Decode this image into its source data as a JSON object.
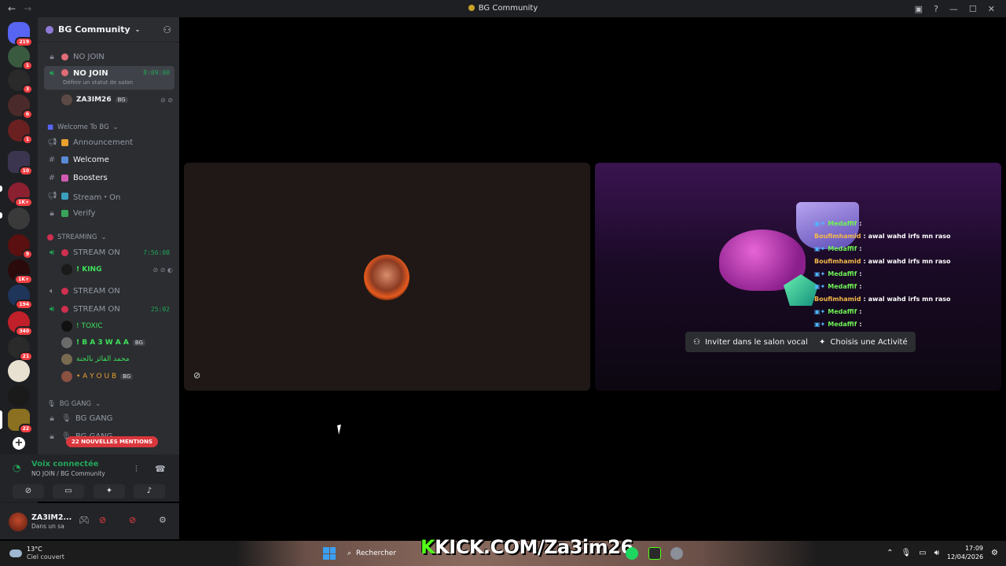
{
  "window": {
    "title": "BG Community"
  },
  "rail": {
    "badges": [
      "219",
      "1",
      "3",
      "6",
      "1",
      "10",
      "1K+",
      "9",
      "1K+",
      "194",
      "340",
      "21",
      "22"
    ]
  },
  "guild": {
    "name": "BG Community"
  },
  "channels": {
    "no_join_1": "NO JOIN",
    "no_join_2": "NO JOIN",
    "no_join_2_time": "8:09:00",
    "no_join_2_status": "Définir un statut de salon",
    "user_za3im": "ZA3IM26",
    "cat_welcome": "Welcome To BG",
    "announcement": "Announcement",
    "welcome": "Welcome",
    "boosters": "Boosters",
    "stream": "Stream・On",
    "verify": "Verify",
    "cat_streaming": "STREAMING",
    "stream_on_1": "STREAM ON",
    "stream_on_1_time": "7:56:08",
    "user_king": "! KING",
    "stream_on_2": "STREAM ON",
    "stream_on_3": "STREAM ON",
    "stream_on_3_time": "25:02",
    "user_toxic": "! TOXIC",
    "user_ba3waa": "! B A 3 W A A",
    "user_arabic": "محمد الفائز بالجنة",
    "user_ayoub": "• A Y O U B",
    "tag_bg": "BG",
    "cat_bggang": "BG GANG",
    "bg_gang_1": "BG GANG",
    "bg_gang_2": "BG GANG",
    "mentions": "22 NOUVELLES MENTIONS"
  },
  "voice": {
    "status": "Voix connectée",
    "location": "NO JOIN / BG Community"
  },
  "userpanel": {
    "name": "ZA3IM2...",
    "status": "Dans un sa"
  },
  "activity": {
    "invite": "Inviter dans le salon vocal",
    "choose": "Choisis une Activité"
  },
  "chat": [
    {
      "user": "Medaffif",
      "color": "green",
      "msg": ""
    },
    {
      "user": "Boufimhamid",
      "color": "orange",
      "msg": "awal wahd irfs mn raso"
    },
    {
      "user": "Medaffif",
      "color": "green",
      "msg": ""
    },
    {
      "user": "Boufimhamid",
      "color": "orange",
      "msg": "awal wahd irfs mn raso"
    },
    {
      "user": "Medaffif",
      "color": "green",
      "msg": ""
    },
    {
      "user": "Medaffif",
      "color": "green",
      "msg": ""
    },
    {
      "user": "Boufimhamid",
      "color": "orange",
      "msg": "awal wahd irfs mn raso"
    },
    {
      "user": "Medaffif",
      "color": "green",
      "msg": ""
    },
    {
      "user": "Medaffif",
      "color": "green",
      "msg": ""
    },
    {
      "user": "Medaffif",
      "color": "green",
      "msg": ""
    }
  ],
  "overlay": {
    "kick_prefix": "K",
    "kick_text": "KICK.COM/Za3im26"
  },
  "taskbar": {
    "temp": "13°C",
    "weather": "Ciel couvert",
    "search": "Rechercher",
    "time": "17:09",
    "date": "12/04/2026"
  },
  "colors": {
    "accent_green": "#23a55a",
    "danger": "#f23f43",
    "kick_green": "#53fc18"
  }
}
